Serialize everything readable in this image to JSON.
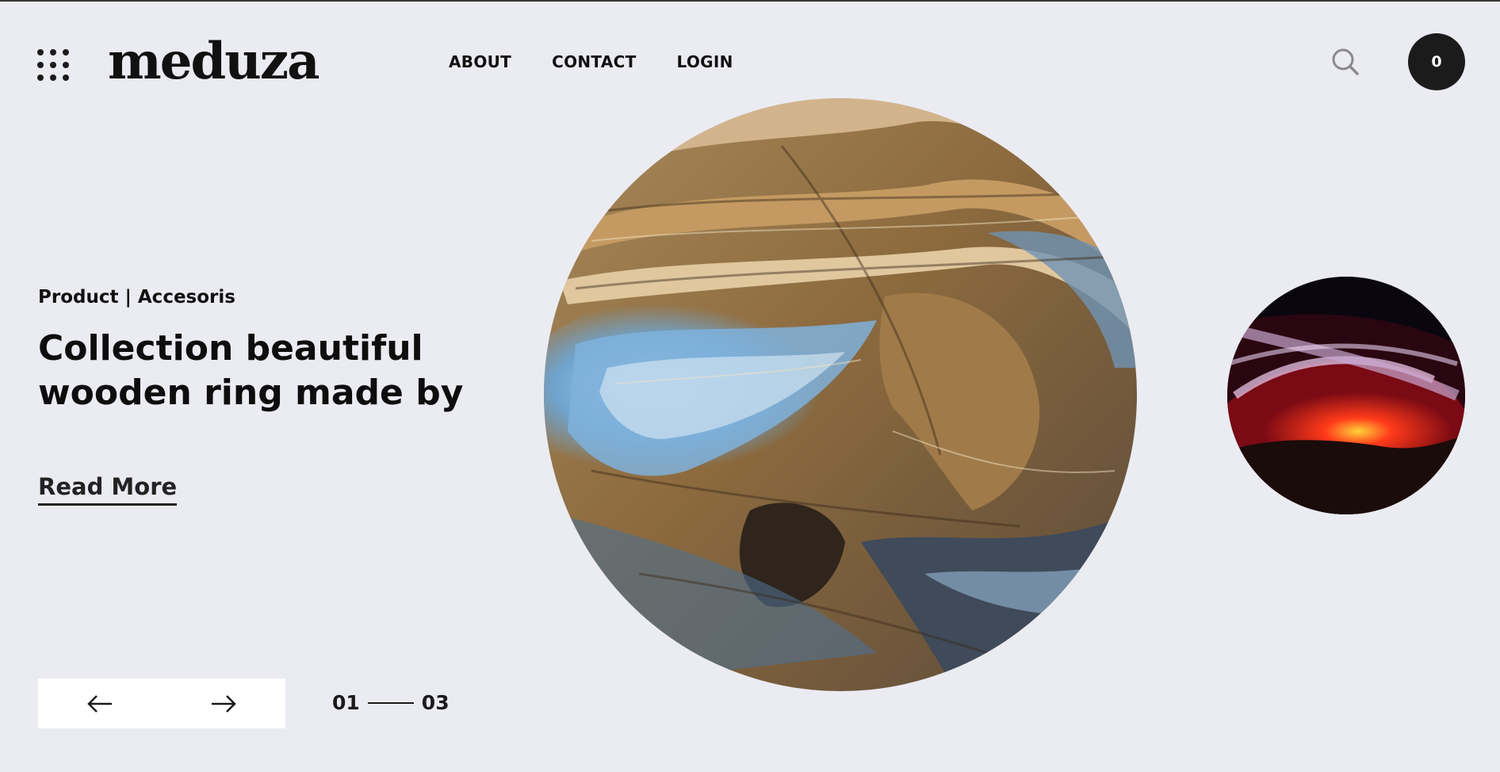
{
  "brand": {
    "logo_text": "meduza"
  },
  "nav": {
    "items": [
      {
        "label": "ABOUT"
      },
      {
        "label": "CONTACT"
      },
      {
        "label": "LOGIN"
      }
    ]
  },
  "header": {
    "cart_count": "0",
    "search_icon": "search-icon",
    "menu_icon": "grid-menu-icon"
  },
  "hero": {
    "breadcrumb": "Product | Accesoris",
    "title_line1": "Collection beautiful",
    "title_line2": "wooden ring made by",
    "read_more": "Read More",
    "slide_current": "01",
    "slide_total": "03"
  },
  "images": {
    "main": "weathered-wood-bark-photo",
    "side": "antelope-canyon-red-photo"
  },
  "colors": {
    "background": "#ebebf2",
    "text": "#111111",
    "cart_bg": "#1b1b1b",
    "arrow_box": "#ffffff"
  }
}
